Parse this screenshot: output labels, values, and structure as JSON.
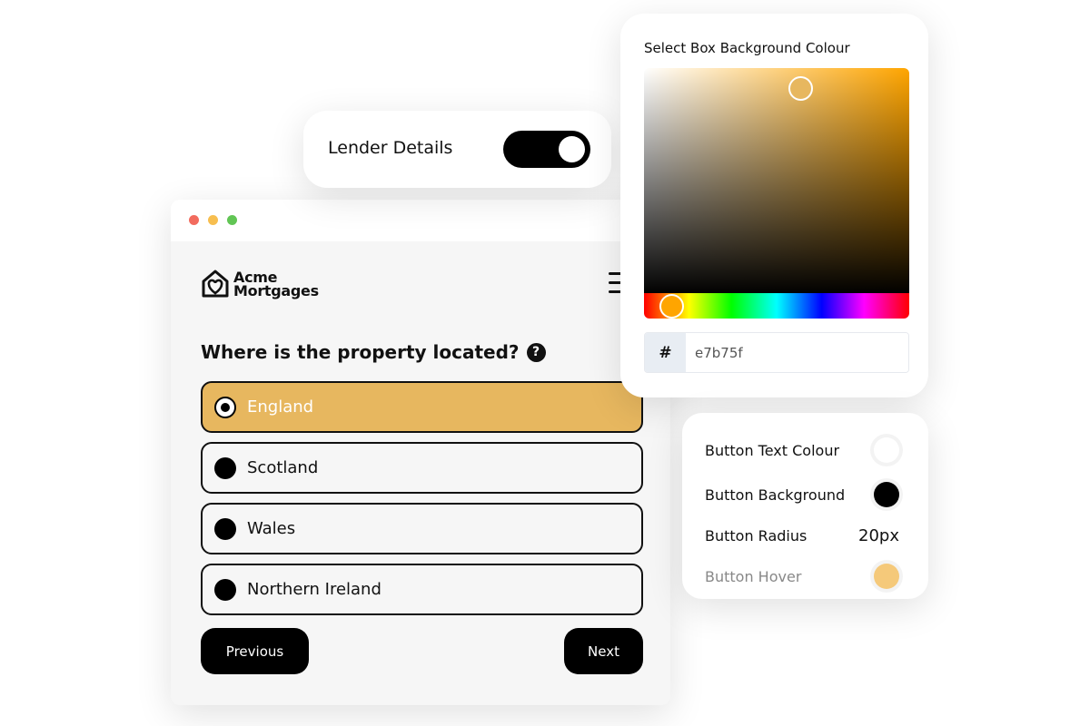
{
  "window": {
    "traffic_lights": [
      "#f26b5e",
      "#f7be4f",
      "#61c554"
    ],
    "brand": {
      "line1": "Acme",
      "line2": "Mortgages",
      "icon": "house-heart-icon"
    },
    "question": "Where is the property located?",
    "options": [
      {
        "label": "England",
        "selected": true
      },
      {
        "label": "Scotland",
        "selected": false
      },
      {
        "label": "Wales",
        "selected": false
      },
      {
        "label": "Northern Ireland",
        "selected": false
      }
    ],
    "previous_label": "Previous",
    "next_label": "Next",
    "accent": "#e7b75f"
  },
  "lender": {
    "label": "Lender Details",
    "enabled": true
  },
  "picker": {
    "title": "Select Box Background Colour",
    "hash": "#",
    "hex_value": "e7b75f"
  },
  "settings": {
    "rows": [
      {
        "label": "Button Text Colour",
        "color": "#ffffff"
      },
      {
        "label": "Button Background",
        "color": "#000000"
      },
      {
        "label": "Button Radius",
        "value": "20px"
      },
      {
        "label": "Button Hover",
        "color": "#f5c97a"
      }
    ]
  }
}
